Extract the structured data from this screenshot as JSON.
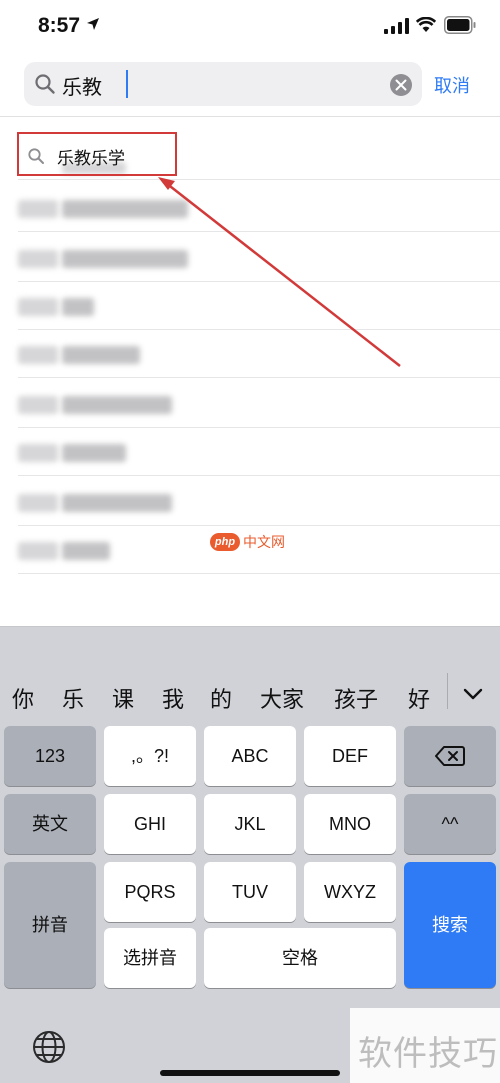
{
  "status_bar": {
    "time": "8:57"
  },
  "search": {
    "query": "乐教",
    "cancel_label": "取消"
  },
  "suggestions": {
    "highlighted": "乐教乐学"
  },
  "watermark": {
    "php": "php",
    "text": "中文网"
  },
  "keyboard": {
    "candidates": [
      "你",
      "乐",
      "课",
      "我",
      "的",
      "大家",
      "孩子",
      "好"
    ],
    "keys": {
      "num": "123",
      "punct": ",。?!",
      "abc": "ABC",
      "def": "DEF",
      "english": "英文",
      "ghi": "GHI",
      "jkl": "JKL",
      "mno": "MNO",
      "emoticon": "^^",
      "pinyin": "拼音",
      "pqrs": "PQRS",
      "tuv": "TUV",
      "wxyz": "WXYZ",
      "search": "搜索",
      "select_pinyin": "选拼音",
      "space": "空格"
    }
  },
  "brand": {
    "text": "软件技巧"
  },
  "colors": {
    "accent": "#2f7bf5",
    "annotation": "#d23a3a",
    "keyboard_bg": "#d0d2d7"
  }
}
